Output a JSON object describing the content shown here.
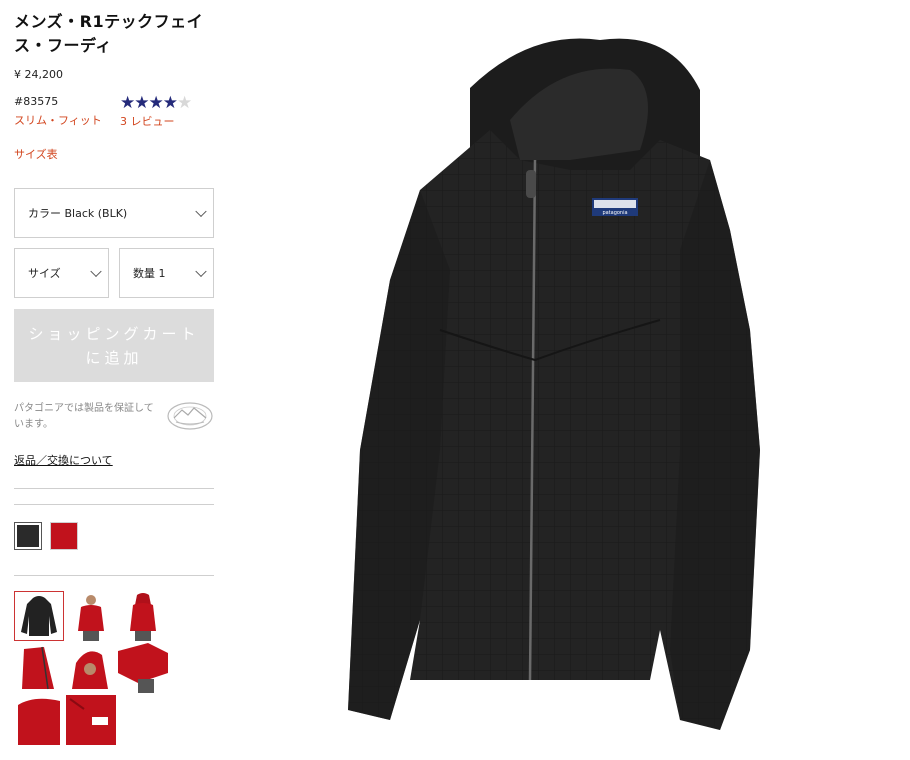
{
  "product": {
    "title": "メンズ・R1テックフェイス・フーディ",
    "price": "¥ 24,200",
    "sku": "#83575",
    "fit": "スリム・フィット",
    "size_chart": "サイズ表",
    "rating": 4,
    "rating_max": 5,
    "reviews": "3 レビュー"
  },
  "selects": {
    "color": "カラー Black (BLK)",
    "size": "サイズ",
    "quantity": "数量 1"
  },
  "cart_button": "ショッピングカートに追加",
  "guarantee_text": "パタゴニアでは製品を保証しています。",
  "returns_link": "返品／交換について",
  "colors": {
    "black": "#2a2a2a",
    "red": "#c1121c",
    "accent": "#d2451e",
    "star": "#242a7a"
  },
  "swatches": [
    "Black",
    "Red"
  ]
}
